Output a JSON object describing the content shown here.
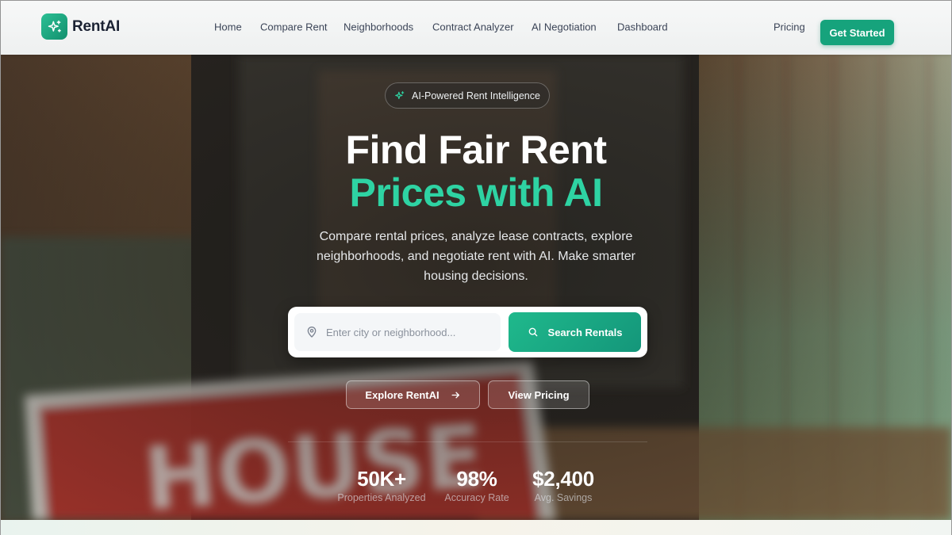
{
  "brand": {
    "name": "RentAI",
    "logo_icon": "sparkles-icon"
  },
  "nav": {
    "links": [
      "Home",
      "Compare Rent",
      "Neighborhoods",
      "Contract Analyzer",
      "AI Negotiation",
      "Dashboard"
    ],
    "pricing": "Pricing",
    "cta": "Get Started"
  },
  "hero": {
    "badge": "AI-Powered Rent Intelligence",
    "headline_line1": "Find Fair Rent",
    "headline_line2": "Prices with AI",
    "subtitle": "Compare rental prices, analyze lease contracts, explore neighborhoods, and negotiate rent with AI. Make smarter housing decisions.",
    "search": {
      "placeholder": "Enter city or neighborhood...",
      "button": "Search Rentals"
    },
    "secondary_buttons": {
      "explore": "Explore RentAI",
      "pricing": "View Pricing"
    },
    "stats": [
      {
        "value": "50K+",
        "label": "Properties Analyzed"
      },
      {
        "value": "98%",
        "label": "Accuracy Rate"
      },
      {
        "value": "$2,400",
        "label": "Avg. Savings"
      }
    ]
  },
  "colors": {
    "accent": "#16a37c",
    "accent_text": "#2ed3a3",
    "nav_text": "#3b4457"
  }
}
